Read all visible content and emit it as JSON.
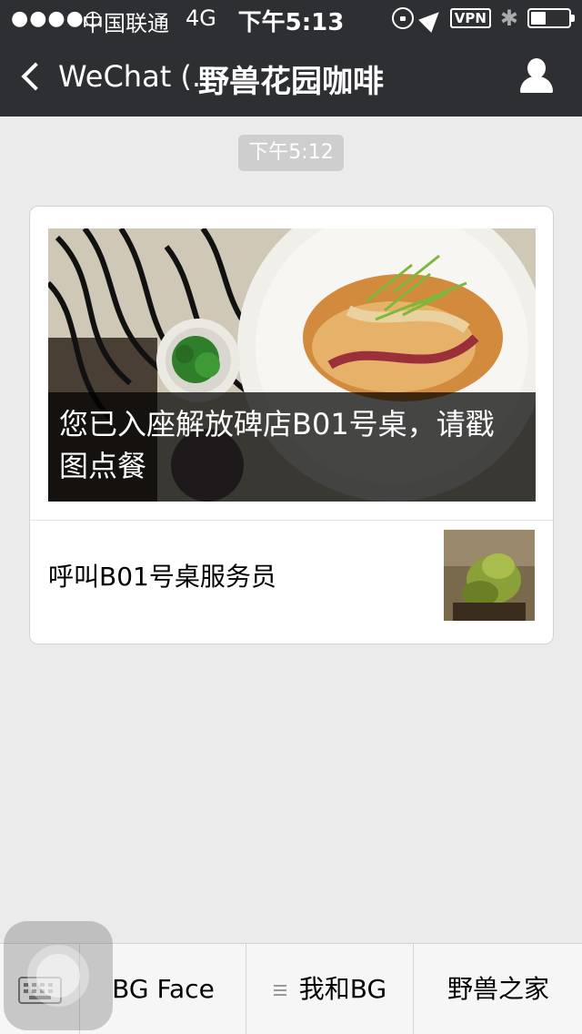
{
  "status_bar": {
    "signal": "●●●●○",
    "carrier": "中国联通",
    "network": "4G",
    "time": "下午5:13",
    "vpn": "VPN",
    "bluetooth": "✱"
  },
  "nav": {
    "back_label": "WeChat (...",
    "title": "野兽花园咖啡",
    "profile_icon": "person-icon"
  },
  "chat": {
    "timestamp": "下午5:12",
    "article": {
      "cover_caption": "您已入座解放碑店B01号桌，请戳图点餐",
      "sub_items": [
        {
          "label": "呼叫B01号桌服务员"
        }
      ]
    }
  },
  "bottom_menu": {
    "keyboard_icon": "keyboard-icon",
    "items": [
      {
        "label": "BG Face"
      },
      {
        "label": "我和BG"
      },
      {
        "label": "野兽之家"
      }
    ]
  },
  "colors": {
    "nav_background": "#2e2f33",
    "chat_background": "#ebebeb",
    "timestamp_pill": "#cecece"
  }
}
